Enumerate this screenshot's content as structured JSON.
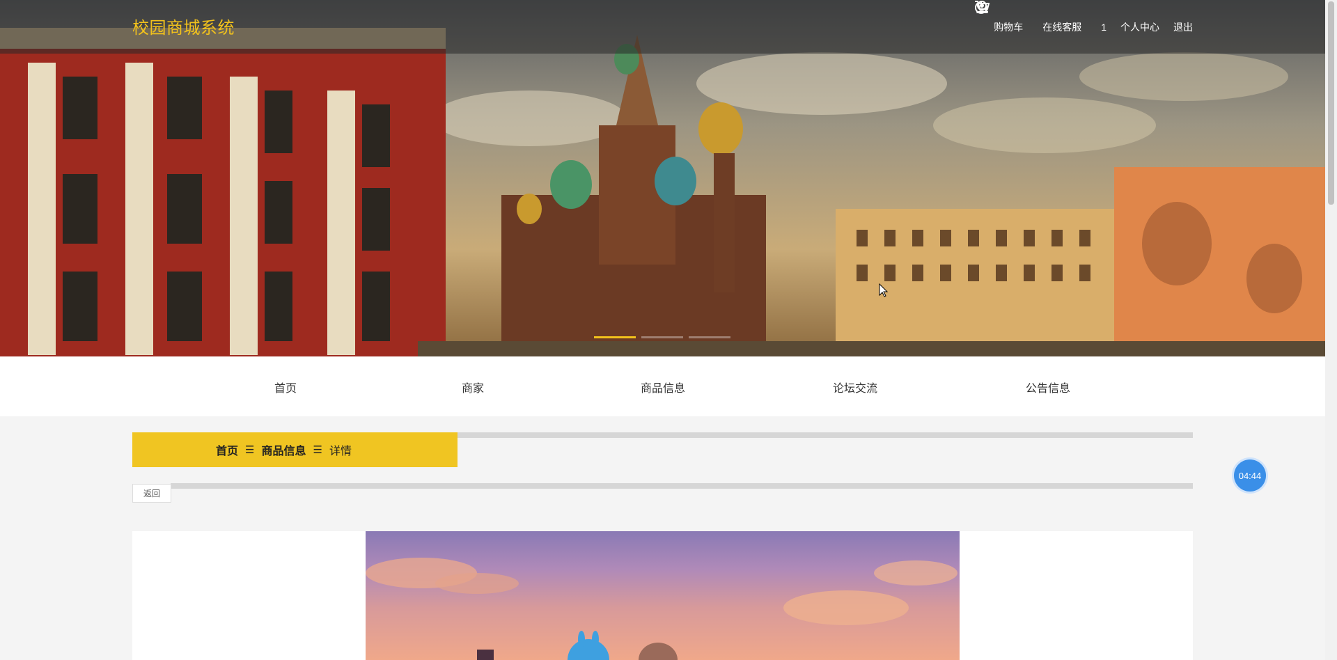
{
  "header": {
    "logo": "校园商城系统",
    "links": [
      {
        "label": "购物车",
        "icon": "cart-icon"
      },
      {
        "label": "在线客服",
        "icon": "user-headset-icon"
      },
      {
        "label": "1",
        "icon": ""
      },
      {
        "label": "个人中心",
        "icon": ""
      },
      {
        "label": "退出",
        "icon": "power-icon"
      }
    ]
  },
  "menu": [
    {
      "label": "首页"
    },
    {
      "label": "商家"
    },
    {
      "label": "商品信息"
    },
    {
      "label": "论坛交流"
    },
    {
      "label": "公告信息"
    }
  ],
  "breadcrumb": {
    "home": "首页",
    "sep1": "☰",
    "section": "商品信息",
    "sep2": "☰",
    "current": "详情"
  },
  "back_label": "返回",
  "timer": "04:44",
  "colors": {
    "accent": "#f0c522",
    "logo": "#f2c21c",
    "timer": "#3a8fe8"
  }
}
